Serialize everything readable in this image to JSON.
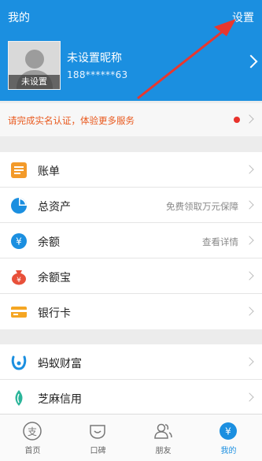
{
  "header": {
    "title": "我的",
    "settings_label": "设置",
    "avatar_tag": "未设置",
    "nickname": "未设置昵称",
    "phone": "188******63"
  },
  "notice": {
    "text": "请完成实名认证，体验更多服务"
  },
  "menu": {
    "bill": {
      "label": "账单"
    },
    "assets": {
      "label": "总资产",
      "extra": "免费领取万元保障"
    },
    "balance": {
      "label": "余额",
      "extra": "查看详情"
    },
    "yuebao": {
      "label": "余额宝"
    },
    "bank_card": {
      "label": "银行卡"
    },
    "ant_fortune": {
      "label": "蚂蚁财富"
    },
    "sesame_credit": {
      "label": "芝麻信用"
    }
  },
  "tabbar": {
    "home": "首页",
    "koubei": "口碑",
    "friends": "朋友",
    "mine": "我的"
  },
  "colors": {
    "brand": "#1b8fe0",
    "notice": "#e9591e",
    "annotation_arrow": "#e8372e"
  }
}
